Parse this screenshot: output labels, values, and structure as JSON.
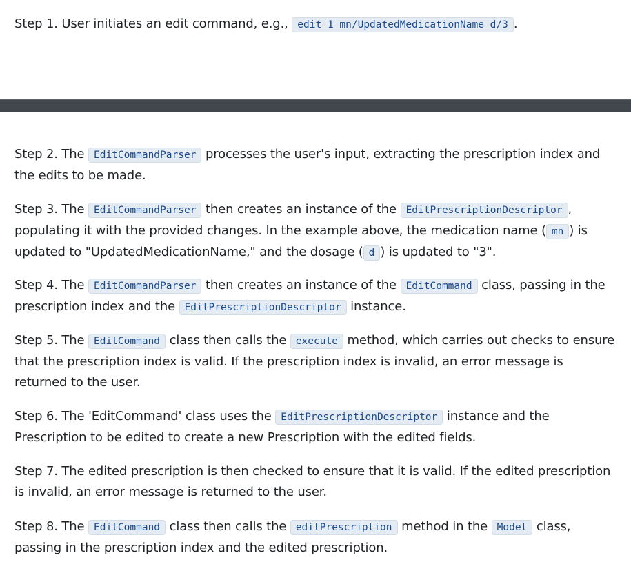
{
  "step1": {
    "t1": "Step 1. User initiates an edit command, e.g., ",
    "c1": "edit 1 mn/UpdatedMedicationName d/3",
    "t2": "."
  },
  "step2": {
    "t1": "Step 2. The ",
    "c1": "EditCommandParser",
    "t2": " processes the user's input, extracting the prescription index and the edits to be made."
  },
  "step3": {
    "t1": "Step 3. The ",
    "c1": "EditCommandParser",
    "t2": " then creates an instance of the ",
    "c2": "EditPrescriptionDescriptor",
    "t3": ", populating it with the provided changes. In the example above, the medication name (",
    "c3": "mn",
    "t4": ") is updated to \"UpdatedMedicationName,\" and the dosage (",
    "c4": "d",
    "t5": ") is updated to \"3\"."
  },
  "step4": {
    "t1": "Step 4. The ",
    "c1": "EditCommandParser",
    "t2": " then creates an instance of the ",
    "c2": "EditCommand",
    "t3": " class, passing in the prescription index and the ",
    "c3": "EditPrescriptionDescriptor",
    "t4": " instance."
  },
  "step5": {
    "t1": "Step 5. The ",
    "c1": "EditCommand",
    "t2": " class then calls the ",
    "c2": "execute",
    "t3": " method, which carries out checks to ensure that the prescription index is valid. If the prescription index is invalid, an error message is returned to the user."
  },
  "step6": {
    "t1": "Step 6. The 'EditCommand' class uses the ",
    "c1": "EditPrescriptionDescriptor",
    "t2": " instance and the Prescription to be edited to create a new Prescription with the edited fields."
  },
  "step7": {
    "t1": "Step 7. The edited prescription is then checked to ensure that it is valid. If the edited prescription is invalid, an error message is returned to the user."
  },
  "step8": {
    "t1": "Step 8. The ",
    "c1": "EditCommand",
    "t2": " class then calls the ",
    "c2": "editPrescription",
    "t3": " method in the ",
    "c3": "Model",
    "t4": " class, passing in the prescription index and the edited prescription."
  }
}
